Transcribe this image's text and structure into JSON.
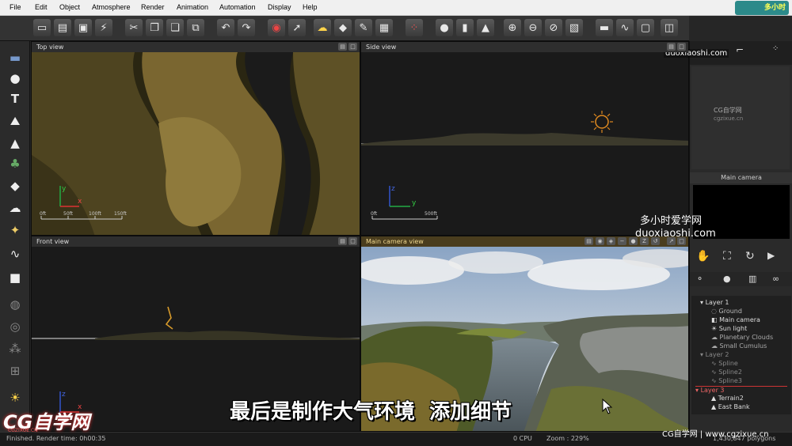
{
  "menu": [
    "File",
    "Edit",
    "Object",
    "Atmosphere",
    "Render",
    "Animation",
    "Automation",
    "Display",
    "Help"
  ],
  "toolbar_icons": [
    "new-file-icon",
    "open-file-icon",
    "save-icon",
    "save-as-icon",
    "cut-icon",
    "copy-icon",
    "paste-icon",
    "duplicate-icon",
    "undo-icon",
    "redo-icon",
    "render-icon",
    "render-area-icon",
    "atmosphere-icon",
    "object-icon",
    "material-icon",
    "scene-icon",
    "color-picker-icon",
    "sphere-icon",
    "bar-icon",
    "terrain-icon",
    "zoom-in-icon",
    "zoom-out-icon",
    "zoom-minus-icon",
    "fit-icon",
    "film-icon",
    "curve-icon",
    "frame-icon",
    "camera-icon"
  ],
  "left_tools": [
    "plane-icon",
    "sphere-tool-icon",
    "text-tool-icon",
    "terrain-tool-icon",
    "mountain-tool-icon",
    "plant-tool-icon",
    "rock-tool-icon",
    "cloud-tool-icon",
    "light-tool-icon",
    "spline-tool-icon",
    "cube-tool-icon",
    "boolean-union-icon",
    "boolean-intersect-icon",
    "metablob-icon",
    "group-icon",
    "sun-tool-icon"
  ],
  "viewports": {
    "top": {
      "title": "Top view",
      "scale": [
        "0ft",
        "50ft",
        "100ft",
        "150ft"
      ]
    },
    "side": {
      "title": "Side view",
      "scale": [
        "0ft",
        "500ft"
      ]
    },
    "front": {
      "title": "Front view"
    },
    "camera": {
      "title": "Main camera view"
    }
  },
  "right_panel": {
    "section1": "CG自学网",
    "section1b": "cgzixue.cn",
    "camera_label": "Main camera",
    "layers": [
      {
        "label": "Layer 1",
        "indent": 0,
        "hl": false
      },
      {
        "label": "Ground",
        "indent": 1,
        "hl": false
      },
      {
        "label": "Main camera",
        "indent": 1,
        "hl": false
      },
      {
        "label": "Sun light",
        "indent": 1,
        "hl": false
      },
      {
        "label": "Planetary Clouds",
        "indent": 1,
        "hl": false
      },
      {
        "label": "Small Cumulus",
        "indent": 1,
        "hl": false
      },
      {
        "label": "Layer 2",
        "indent": 0,
        "hl": false
      },
      {
        "label": "Spline",
        "indent": 1,
        "hl": false
      },
      {
        "label": "Spline2",
        "indent": 1,
        "hl": false
      },
      {
        "label": "Spline3",
        "indent": 1,
        "hl": false
      },
      {
        "label": "Layer 3",
        "indent": 0,
        "hl": true
      },
      {
        "label": "Terrain2",
        "indent": 1,
        "hl": false
      },
      {
        "label": "East Bank",
        "indent": 1,
        "hl": false
      }
    ]
  },
  "status": {
    "left": "Finished. Render time: 0h00:35",
    "cpu": "0 CPU",
    "zoom": "Zoom : 229%",
    "polygons": "1,430,847 polygons"
  },
  "watermarks": {
    "url_top": "duoxiaoshi.com",
    "cn_name": "多小时爱学网",
    "url_mid": "duoxiaoshi.com",
    "cg_logo": "CG自学网",
    "cg_sub": "CGZIXUE.CN",
    "bottom_right": "CG自学网 | www.cgzixue.cn",
    "logo_top": "多小时"
  },
  "subtitle": "最后是制作大气环境  添加细节",
  "colors": {
    "terrain": "#6b5a2a",
    "accent": "#d04040"
  }
}
